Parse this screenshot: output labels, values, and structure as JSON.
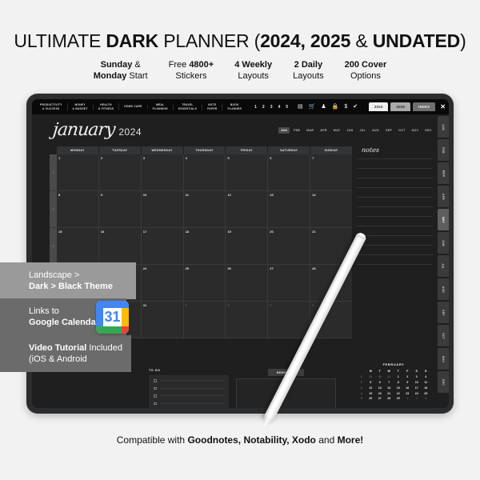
{
  "header": {
    "title_parts": [
      {
        "text": "ULTIMATE ",
        "bold": false
      },
      {
        "text": "DARK ",
        "bold": true
      },
      {
        "text": "PLANNER (",
        "bold": false
      },
      {
        "text": "2024, 2025",
        "bold": true
      },
      {
        "text": " & ",
        "bold": false
      },
      {
        "text": "UNDATED",
        "bold": true
      },
      {
        "text": ")",
        "bold": false
      }
    ],
    "title_plain": "ULTIMATE DARK PLANNER (2024, 2025 & UNDATED)",
    "features": [
      {
        "line1_bold": "Sunday",
        "line1_rest": " &",
        "line2_bold": "Monday",
        "line2_rest": " Start"
      },
      {
        "line1_bold": "",
        "line1_rest": "Free ",
        "line1_bold2": "4800+",
        "line2_bold": "",
        "line2_rest": "Stickers"
      },
      {
        "line1_bold": "4 Weekly",
        "line1_rest": "",
        "line2_bold": "",
        "line2_rest": "Layouts"
      },
      {
        "line1_bold": "2 Daily",
        "line1_rest": "",
        "line2_bold": "",
        "line2_rest": "Layouts"
      },
      {
        "line1_bold": "200 Cover",
        "line1_rest": "",
        "line2_bold": "",
        "line2_rest": "Options"
      }
    ]
  },
  "toolbar": {
    "tabs": [
      "PRODUCTIVITY\n& SUCCESS",
      "MONEY\n& BUDGET",
      "HEALTH\n& FITNESS",
      "HOME CARE",
      "MEAL\nPLANNING",
      "TRAVEL\nESSENTIALS",
      "NOTE\nPAPER",
      "BOOK\nPLANNER"
    ],
    "numbers": [
      "1",
      "2",
      "3",
      "4",
      "5"
    ],
    "icons": [
      {
        "name": "printer-icon",
        "glyph": "▤"
      },
      {
        "name": "cart-icon",
        "glyph": "🛒"
      },
      {
        "name": "person-icon",
        "glyph": "♟"
      },
      {
        "name": "lock-icon",
        "glyph": "🔒"
      },
      {
        "name": "dollar-icon",
        "glyph": "$"
      },
      {
        "name": "check-icon",
        "glyph": "✔"
      }
    ],
    "year_tabs": [
      {
        "label": "2024",
        "active": true
      },
      {
        "label": "2025",
        "active": false
      },
      {
        "label": "INDEX",
        "active": false
      }
    ],
    "close_label": "✕"
  },
  "planner": {
    "month_name": "january",
    "year": "2024",
    "month_strip": [
      "JAN",
      "FEB",
      "MAR",
      "APR",
      "MAY",
      "JUN",
      "JUL",
      "AUG",
      "SEP",
      "OCT",
      "NOV",
      "DEC"
    ],
    "active_month": "JAN",
    "day_headers": [
      "MONDAY",
      "TUESDAY",
      "WEDNESDAY",
      "THURSDAY",
      "FRIDAY",
      "SATURDAY",
      "SUNDAY"
    ],
    "week_numbers": [
      "1",
      "2",
      "3",
      "4",
      "5"
    ],
    "weeks": [
      [
        {
          "d": "1",
          "out": false
        },
        {
          "d": "2",
          "out": false
        },
        {
          "d": "3",
          "out": false
        },
        {
          "d": "4",
          "out": false
        },
        {
          "d": "5",
          "out": false
        },
        {
          "d": "6",
          "out": false
        },
        {
          "d": "7",
          "out": false
        }
      ],
      [
        {
          "d": "8",
          "out": false
        },
        {
          "d": "9",
          "out": false
        },
        {
          "d": "10",
          "out": false
        },
        {
          "d": "11",
          "out": false
        },
        {
          "d": "12",
          "out": false
        },
        {
          "d": "13",
          "out": false
        },
        {
          "d": "14",
          "out": false
        }
      ],
      [
        {
          "d": "15",
          "out": false
        },
        {
          "d": "16",
          "out": false
        },
        {
          "d": "17",
          "out": false
        },
        {
          "d": "18",
          "out": false
        },
        {
          "d": "19",
          "out": false
        },
        {
          "d": "20",
          "out": false
        },
        {
          "d": "21",
          "out": false
        }
      ],
      [
        {
          "d": "22",
          "out": false
        },
        {
          "d": "23",
          "out": false
        },
        {
          "d": "24",
          "out": false
        },
        {
          "d": "25",
          "out": false
        },
        {
          "d": "26",
          "out": false
        },
        {
          "d": "27",
          "out": false
        },
        {
          "d": "28",
          "out": false
        }
      ],
      [
        {
          "d": "29",
          "out": false
        },
        {
          "d": "30",
          "out": false
        },
        {
          "d": "31",
          "out": false
        },
        {
          "d": "1",
          "out": true
        },
        {
          "d": "2",
          "out": true
        },
        {
          "d": "3",
          "out": true
        },
        {
          "d": "4",
          "out": true
        }
      ]
    ],
    "notes_label": "notes",
    "side_month_tabs": [
      "JAN",
      "FEB",
      "MAR",
      "APR",
      "MAY",
      "JUN",
      "JUL",
      "AUG",
      "SEP",
      "OCT",
      "NOV",
      "DEC"
    ],
    "active_side_tab": "MAY",
    "todo_label": "TO DO",
    "todo_rows": 5,
    "remember_label": "REMEMBER",
    "mini": {
      "title": "FEBRUARY",
      "headers": [
        "M",
        "T",
        "W",
        "T",
        "F",
        "S",
        "S"
      ],
      "week_numbers": [
        "1",
        "2",
        "3",
        "4",
        "5"
      ],
      "weeks": [
        [
          {
            "d": "29",
            "out": true
          },
          {
            "d": "30",
            "out": true
          },
          {
            "d": "31",
            "out": true
          },
          {
            "d": "1",
            "out": false
          },
          {
            "d": "2",
            "out": false
          },
          {
            "d": "3",
            "out": false
          },
          {
            "d": "4",
            "out": false
          }
        ],
        [
          {
            "d": "5",
            "out": false
          },
          {
            "d": "6",
            "out": false
          },
          {
            "d": "7",
            "out": false
          },
          {
            "d": "8",
            "out": false
          },
          {
            "d": "9",
            "out": false
          },
          {
            "d": "10",
            "out": false
          },
          {
            "d": "11",
            "out": false
          }
        ],
        [
          {
            "d": "12",
            "out": false
          },
          {
            "d": "13",
            "out": false
          },
          {
            "d": "14",
            "out": false
          },
          {
            "d": "15",
            "out": false
          },
          {
            "d": "16",
            "out": false
          },
          {
            "d": "17",
            "out": false
          },
          {
            "d": "18",
            "out": false
          }
        ],
        [
          {
            "d": "19",
            "out": false
          },
          {
            "d": "20",
            "out": false
          },
          {
            "d": "21",
            "out": false
          },
          {
            "d": "22",
            "out": false
          },
          {
            "d": "23",
            "out": false
          },
          {
            "d": "24",
            "out": false
          },
          {
            "d": "25",
            "out": false
          }
        ],
        [
          {
            "d": "26",
            "out": false
          },
          {
            "d": "27",
            "out": false
          },
          {
            "d": "28",
            "out": false
          },
          {
            "d": "29",
            "out": false
          },
          {
            "d": "1",
            "out": true
          },
          {
            "d": "2",
            "out": true
          },
          {
            "d": "3",
            "out": true
          }
        ]
      ]
    }
  },
  "banners": [
    {
      "line1": "Landscape >",
      "line2_bold": "Dark > Black Theme",
      "line2_rest": ""
    },
    {
      "line1": "Links to",
      "line2_bold": "Google Calendar",
      "line2_rest": ""
    },
    {
      "line1_bold": "Video Tutorial",
      "line1_rest": " Included",
      "line2": "(iOS & Android"
    }
  ],
  "google_calendar_icon": {
    "day": "31"
  },
  "footer": {
    "prefix": "Compatible with ",
    "apps": "Goodnotes, Notability, Xodo",
    "mid": " and ",
    "suffix": "More!",
    "plain": "Compatible with Goodnotes, Notability, Xodo and More!"
  },
  "colors": {
    "page_bg": "#f2f2f2",
    "tablet_frame": "#2b2c2e",
    "screen_bg": "#1f1f1f",
    "toolbar_bg": "#090909",
    "cell_bg": "#2b2b2b",
    "banner_light": "#9a9a9a",
    "banner_dark": "#6b6b6b",
    "gcal_blue": "#4285f4",
    "gcal_green": "#34a853",
    "gcal_yellow": "#fbbc05",
    "gcal_red": "#ea4335"
  }
}
